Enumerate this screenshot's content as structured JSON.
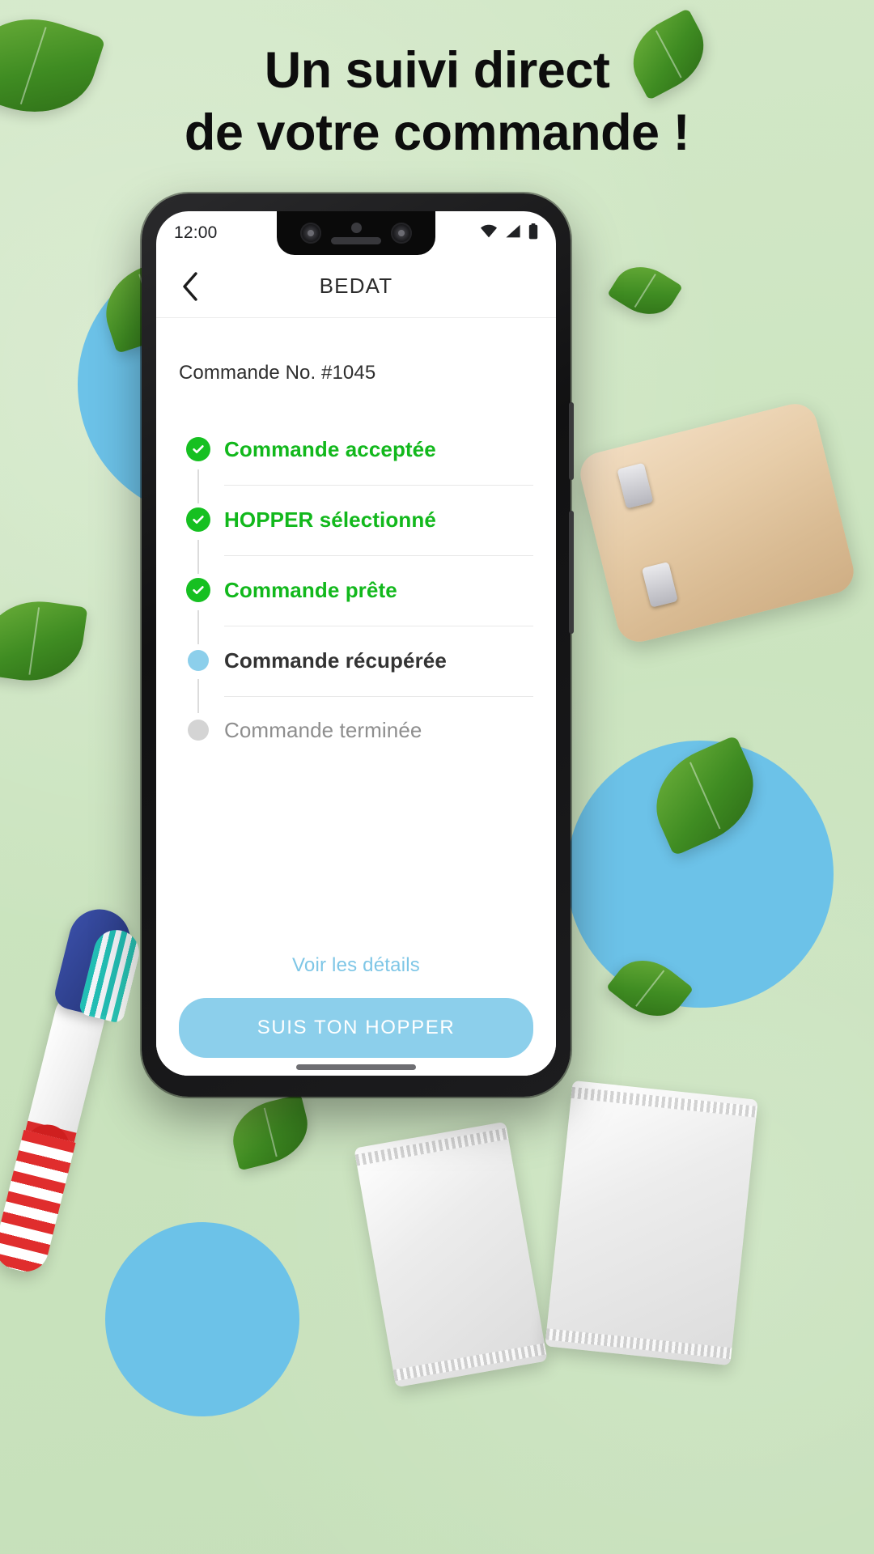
{
  "promo": {
    "headline_line1": "Un suivi direct",
    "headline_line2": "de votre commande !",
    "background_color": "#cfe6c4",
    "accent_blue": "#6cc2e8"
  },
  "phone": {
    "status_bar": {
      "time": "12:00",
      "icons": [
        "wifi-icon",
        "cellular-signal-icon",
        "battery-icon"
      ]
    },
    "app_bar": {
      "back_icon": "chevron-left-icon",
      "title": "BEDAT"
    },
    "screen": {
      "order_number": "Commande No. #1045",
      "timeline": [
        {
          "label": "Commande acceptée",
          "state": "done",
          "marker": "check-circle-icon",
          "color": "#12b81c"
        },
        {
          "label": "HOPPER sélectionné",
          "state": "done",
          "marker": "check-circle-icon",
          "color": "#12b81c"
        },
        {
          "label": "Commande prête",
          "state": "done",
          "marker": "check-circle-icon",
          "color": "#12b81c"
        },
        {
          "label": "Commande récupérée",
          "state": "active",
          "marker": "filled-dot-icon",
          "color": "#333333"
        },
        {
          "label": "Commande terminée",
          "state": "pending",
          "marker": "filled-dot-icon",
          "color": "#8e8e8e"
        }
      ],
      "details_link": "Voir les détails",
      "cta_label": "SUIS TON HOPPER",
      "cta_color": "#8ccfeb",
      "link_color": "#7ec6e6"
    }
  }
}
